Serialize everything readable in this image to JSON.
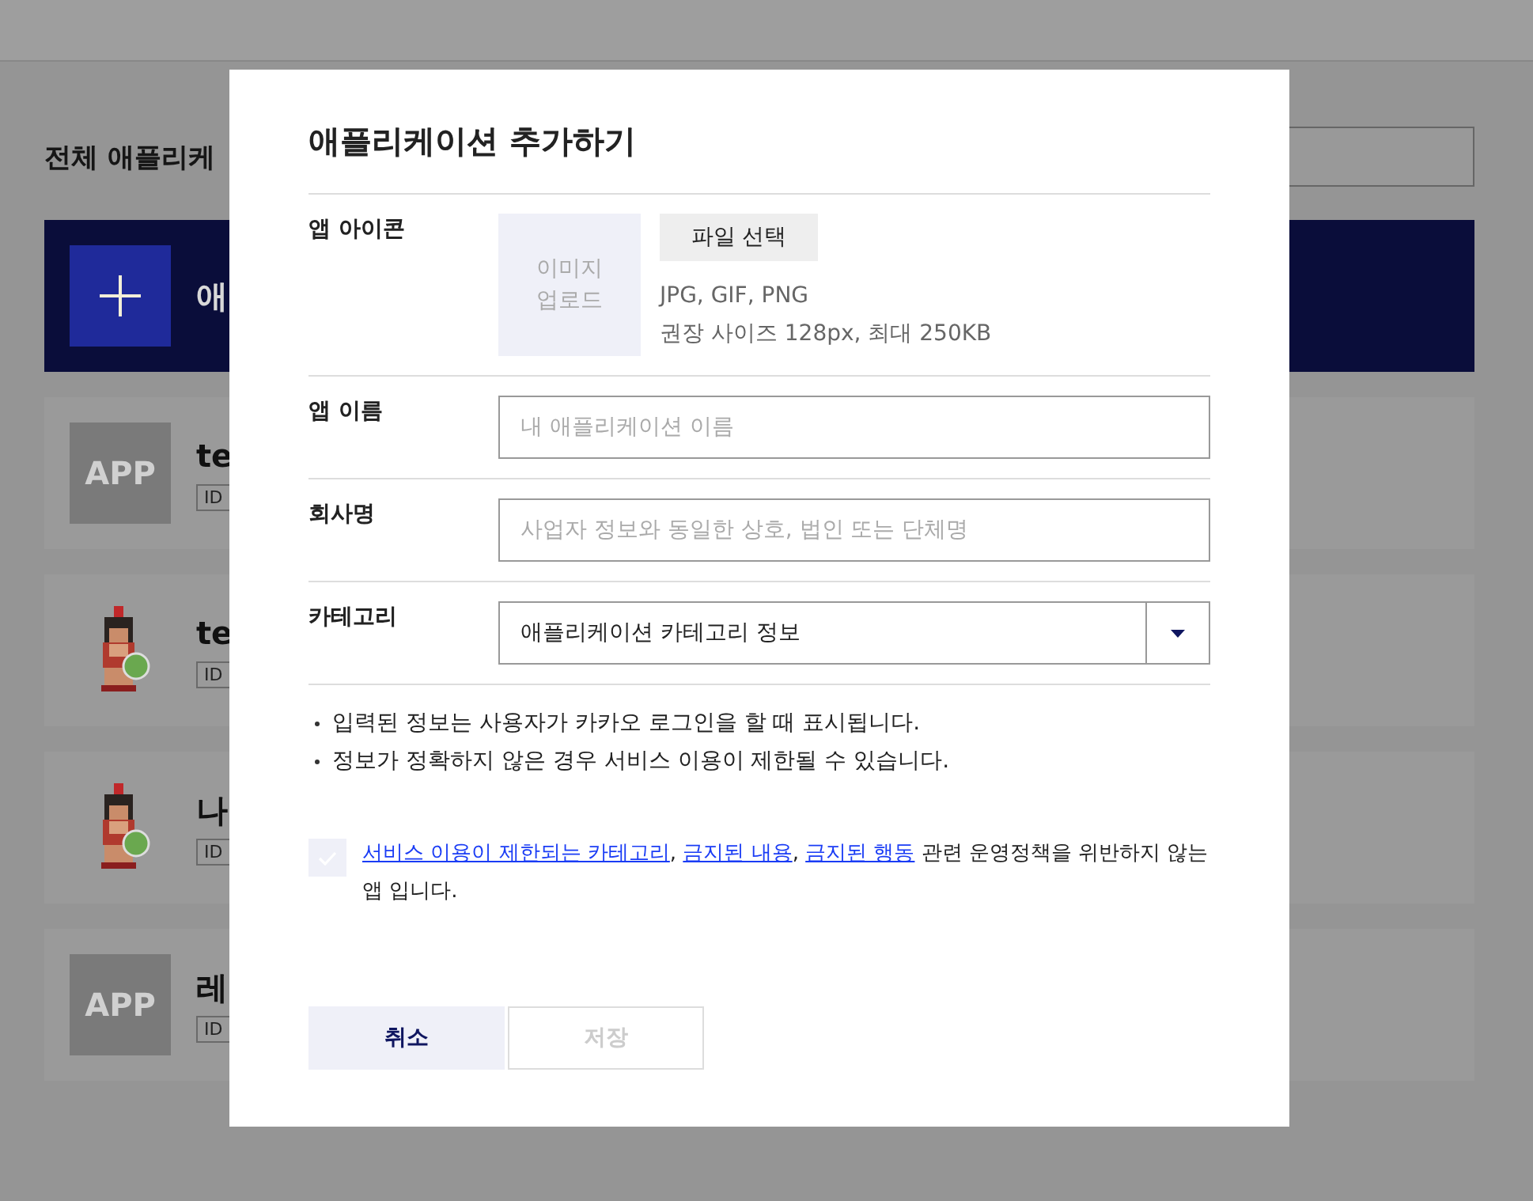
{
  "page": {
    "title": "전체 애플리케",
    "add_card": {
      "label": "애"
    },
    "apps": [
      {
        "kind": "placeholder",
        "icon_text": "APP",
        "name": "te",
        "id_label": "ID"
      },
      {
        "kind": "character",
        "name": "te",
        "id_label": "ID"
      },
      {
        "kind": "character",
        "name": "나",
        "id_label": "ID"
      },
      {
        "kind": "placeholder",
        "icon_text": "APP",
        "name": "레",
        "id_label": "ID"
      }
    ]
  },
  "dialog": {
    "title": "애플리케이션 추가하기",
    "icon_row": {
      "label": "앱 아이콘",
      "upload_text": "이미지\n업로드",
      "file_button": "파일 선택",
      "formats": "JPG, GIF, PNG",
      "size_hint": "권장 사이즈 128px, 최대 250KB"
    },
    "fields": [
      {
        "kind": "input",
        "label": "앱 이름",
        "placeholder": "내 애플리케이션 이름"
      },
      {
        "kind": "input",
        "label": "회사명",
        "placeholder": "사업자 정보와 동일한 상호, 법인 또는 단체명"
      },
      {
        "kind": "select",
        "label": "카테고리",
        "value": "애플리케이션 카테고리 정보"
      }
    ],
    "notes": [
      "입력된 정보는 사용자가 카카오 로그인을 할 때 표시됩니다.",
      "정보가 정확하지 않은 경우 서비스 이용이 제한될 수 있습니다."
    ],
    "consent": {
      "checked": false,
      "parts": [
        {
          "text": "서비스 이용이 제한되는 카테고리",
          "link": true
        },
        {
          "text": ", ",
          "link": false
        },
        {
          "text": "금지된 내용",
          "link": true
        },
        {
          "text": ", ",
          "link": false
        },
        {
          "text": "금지된 행동",
          "link": true
        },
        {
          "text": " 관련 운영정책을 위반하지 않는 앱 입니다.",
          "link": false
        }
      ]
    },
    "buttons": [
      {
        "label": "취소",
        "kind": "secondary",
        "disabled": false
      },
      {
        "label": "저장",
        "kind": "primary",
        "disabled": true
      }
    ]
  }
}
